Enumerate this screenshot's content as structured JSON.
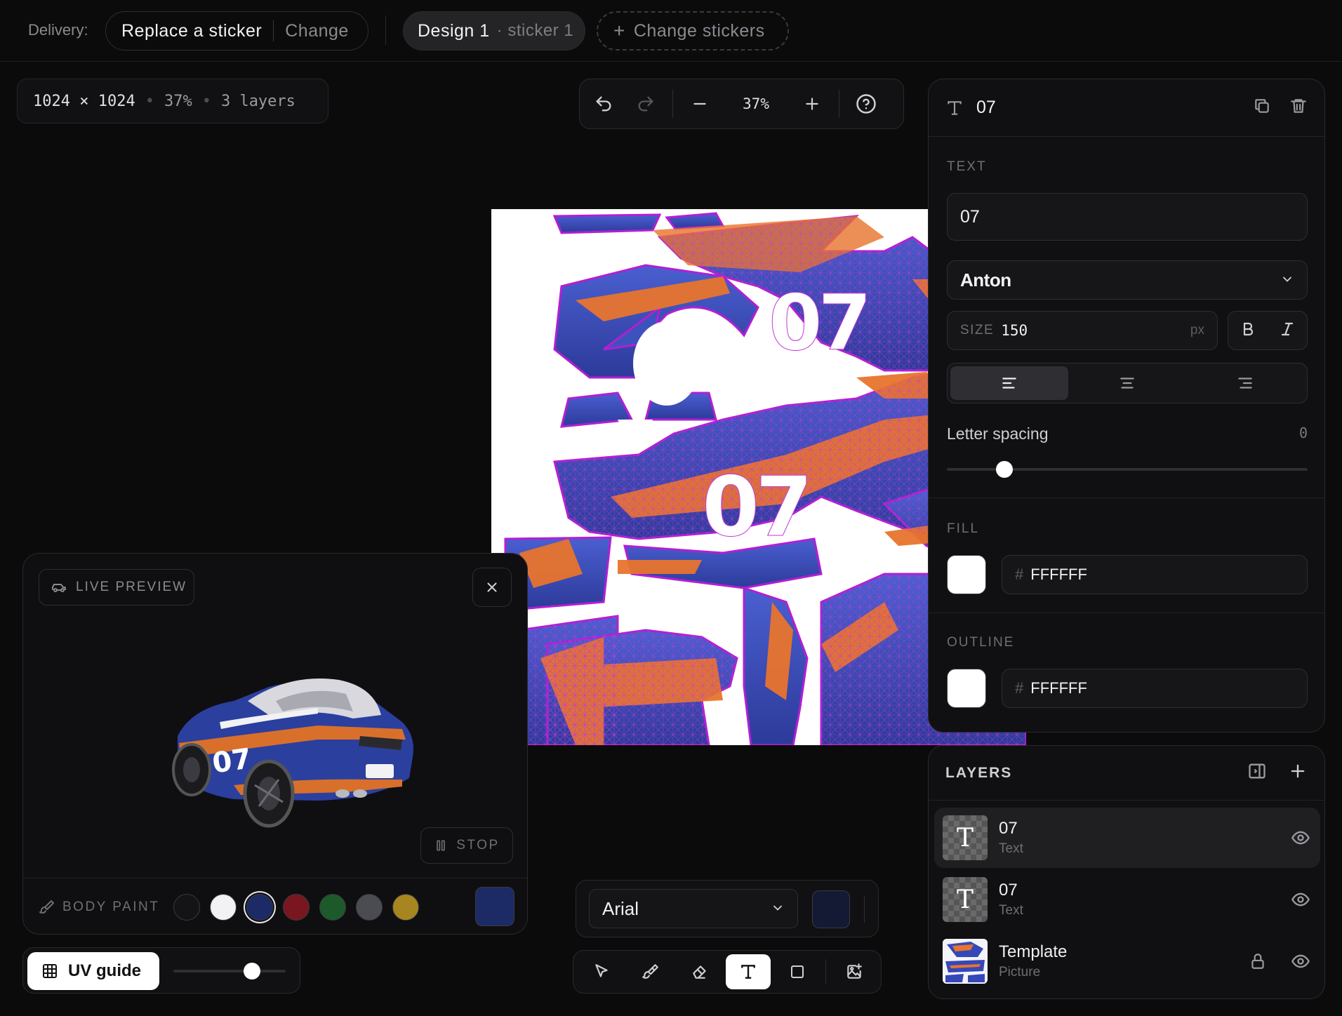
{
  "topbar": {
    "delivery_label": "Delivery:",
    "sticker_pill": {
      "label": "Replace a sticker",
      "change": "Change"
    },
    "design_pill": {
      "label": "Design 1",
      "sub": "· sticker 1"
    },
    "change_stickers": "Change stickers"
  },
  "info": {
    "size": "1024 × 1024",
    "zoom": "37%",
    "layers": "3 layers"
  },
  "canvas_toolbar": {
    "zoom": "37%"
  },
  "texture": {
    "number_text": "07"
  },
  "props": {
    "title": "07",
    "text_section": "TEXT",
    "text_value": "07",
    "font": "Anton",
    "size_label": "SIZE",
    "size_value": "150",
    "size_unit": "px",
    "letter_spacing_label": "Letter spacing",
    "letter_spacing_value": "0",
    "letter_spacing_level": 0.16,
    "fill_section": "FILL",
    "fill_hex": "FFFFFF",
    "outline_section": "OUTLINE",
    "outline_hex": "FFFFFF",
    "hash": "#"
  },
  "layers": {
    "title": "LAYERS",
    "items": [
      {
        "name": "07",
        "type": "Text",
        "active": true
      },
      {
        "name": "07",
        "type": "Text",
        "active": false
      },
      {
        "name": "Template",
        "type": "Picture",
        "active": false
      }
    ]
  },
  "preview": {
    "badge": "LIVE PREVIEW",
    "stop": "STOP",
    "body_paint_label": "BODY PAINT",
    "car_number": "07",
    "paint_colors": [
      "#141416",
      "#f2f2f4",
      "#1c2a66",
      "#7a1620",
      "#1d5a2a",
      "#4a4c52",
      "#a8861f"
    ],
    "current_paint": "#1c2a66"
  },
  "uv_guide": {
    "label": "UV guide",
    "opacity_level": 0.7
  },
  "fontbar": {
    "font": "Arial",
    "color": "#141a33"
  }
}
